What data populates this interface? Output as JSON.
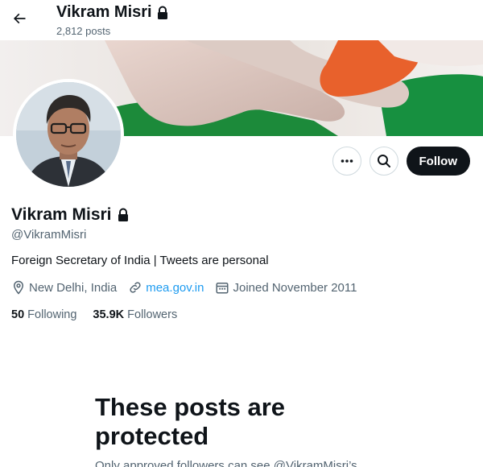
{
  "header": {
    "title": "Vikram Misri",
    "post_count": "2,812 posts"
  },
  "profile": {
    "name": "Vikram Misri",
    "handle": "@VikramMisri",
    "bio": "Foreign Secretary of India | Tweets are personal",
    "location": "New Delhi, India",
    "website": "mea.gov.in",
    "joined": "Joined November 2011",
    "following_count": "50",
    "following_label": "Following",
    "followers_count": "35.9K",
    "followers_label": "Followers"
  },
  "actions": {
    "follow_label": "Follow"
  },
  "protected": {
    "title": "These posts are protected",
    "subtitle": "Only approved followers can see @VikramMisri’s"
  },
  "icons": [
    "back-arrow-icon",
    "lock-icon",
    "more-icon",
    "search-icon",
    "location-icon",
    "link-icon",
    "calendar-icon"
  ],
  "colors": {
    "link": "#1d9bf0",
    "follow_button": "#0f1419",
    "secondary_text": "#536471"
  }
}
